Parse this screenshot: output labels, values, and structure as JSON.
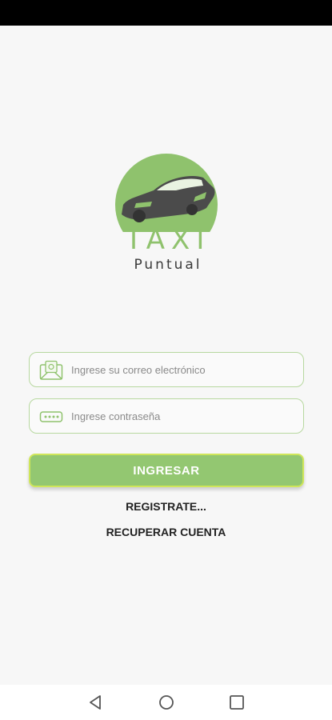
{
  "logo": {
    "title": "TAXI",
    "subtitle": "Puntual",
    "brand_color": "#8fc26d"
  },
  "form": {
    "email_placeholder": "Ingrese su correo electrónico",
    "email_value": "",
    "email_icon": "envelope-icon",
    "password_placeholder": "Ingrese contraseña",
    "password_value": "",
    "password_icon": "password-icon"
  },
  "actions": {
    "login_label": "INGRESAR",
    "register_label": "REGISTRATE...",
    "recover_label": "RECUPERAR CUENTA"
  },
  "colors": {
    "accent": "#93c771",
    "field_border": "#b7d89f",
    "button_border": "#cfe65a"
  },
  "navigation": {
    "back_icon": "back-triangle-icon",
    "home_icon": "home-circle-icon",
    "recent_icon": "recent-apps-square-icon"
  }
}
